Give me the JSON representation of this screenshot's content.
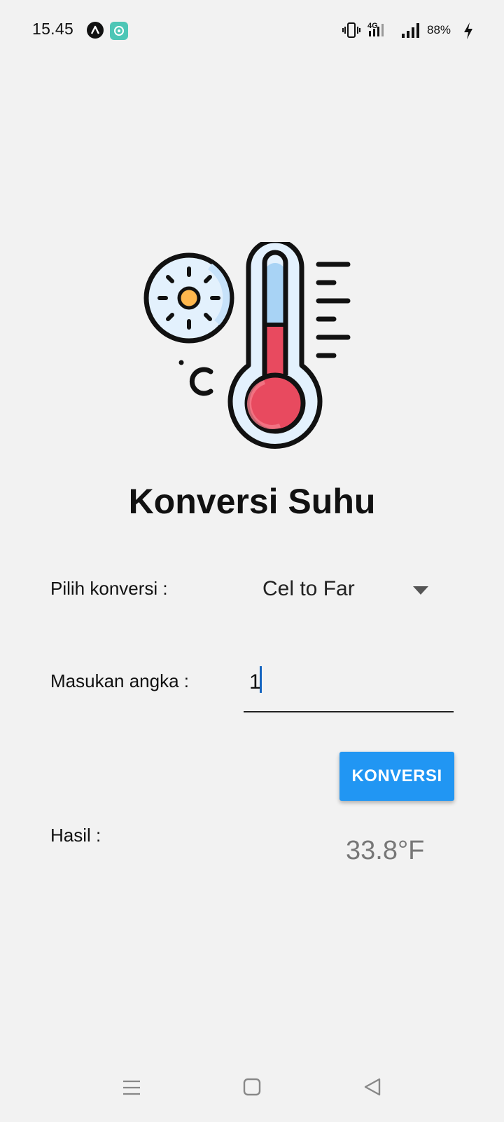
{
  "status_bar": {
    "time": "15.45",
    "battery": "88%",
    "network": "4G"
  },
  "app": {
    "title": "Konversi Suhu",
    "illustration": {
      "icon_name": "thermometer-sun-celsius-icon",
      "unit_glyph": "°C",
      "colors": {
        "mercury": "#e84a5f",
        "sun": "#ffb74d",
        "glass": "#ddeefb",
        "outline": "#111111"
      }
    }
  },
  "form": {
    "select_label": "Pilih konversi :",
    "select_value": "Cel to Far",
    "input_label": "Masukan angka :",
    "input_value": "1",
    "button_label": "KONVERSI",
    "result_label": "Hasil :",
    "result_value": "33.8°F"
  },
  "colors": {
    "button": "#2196f3",
    "background": "#f2f2f2",
    "result_text": "#777777"
  },
  "nav_bar": {
    "icons": [
      "menu-icon",
      "home-icon",
      "back-icon"
    ]
  }
}
